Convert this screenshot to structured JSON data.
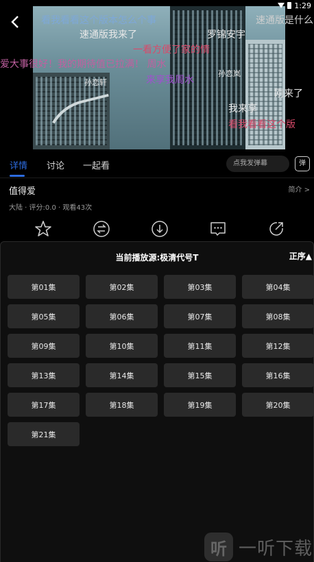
{
  "status": {
    "time": "1:29"
  },
  "video": {
    "danmaku": [
      {
        "text": "看我看看这个版本怎么个事",
        "color": "#7ea8d8"
      },
      {
        "text": "速通版是什么",
        "color": "#cfcfcf"
      },
      {
        "text": "速通版我来了",
        "color": "#e8e8e8"
      },
      {
        "text": "罗锦安宇",
        "color": "#e8e8e8"
      },
      {
        "text": "一看方便了家的情",
        "color": "#d94a6a"
      },
      {
        "text": "爱大事很好！我的期待值已拉满！ 周水",
        "color": "#c060a0"
      },
      {
        "text": "来享我周水",
        "color": "#a050d0"
      },
      {
        "text": "我来享",
        "color": "#e8e8e8"
      },
      {
        "text": "看我看看这个版",
        "color": "#d94a6a"
      },
      {
        "text": "刚来了",
        "color": "#e8e8e8"
      },
      {
        "text": "孙恋轩",
        "color": "#e8e8e8"
      },
      {
        "text": "孙恋岚",
        "color": "#e8e8e8"
      }
    ]
  },
  "tabs": [
    {
      "label": "详情"
    },
    {
      "label": "讨论"
    },
    {
      "label": "一起看"
    }
  ],
  "danmu": {
    "placeholder": "点我发弹幕",
    "toggle_label": "弹"
  },
  "show": {
    "title": "值得爱",
    "intro_link": "简介 >",
    "meta": "大陆 · 评分:0.0 · 观看43次"
  },
  "panel": {
    "title": "当前播放源:极清代号T",
    "sort_label": "正序▲",
    "episodes": [
      "第01集",
      "第02集",
      "第03集",
      "第04集",
      "第05集",
      "第06集",
      "第07集",
      "第08集",
      "第09集",
      "第10集",
      "第11集",
      "第12集",
      "第13集",
      "第14集",
      "第15集",
      "第16集",
      "第17集",
      "第18集",
      "第19集",
      "第20集",
      "第21集"
    ]
  },
  "watermark": {
    "logo_char": "听",
    "text": "一听下载"
  }
}
